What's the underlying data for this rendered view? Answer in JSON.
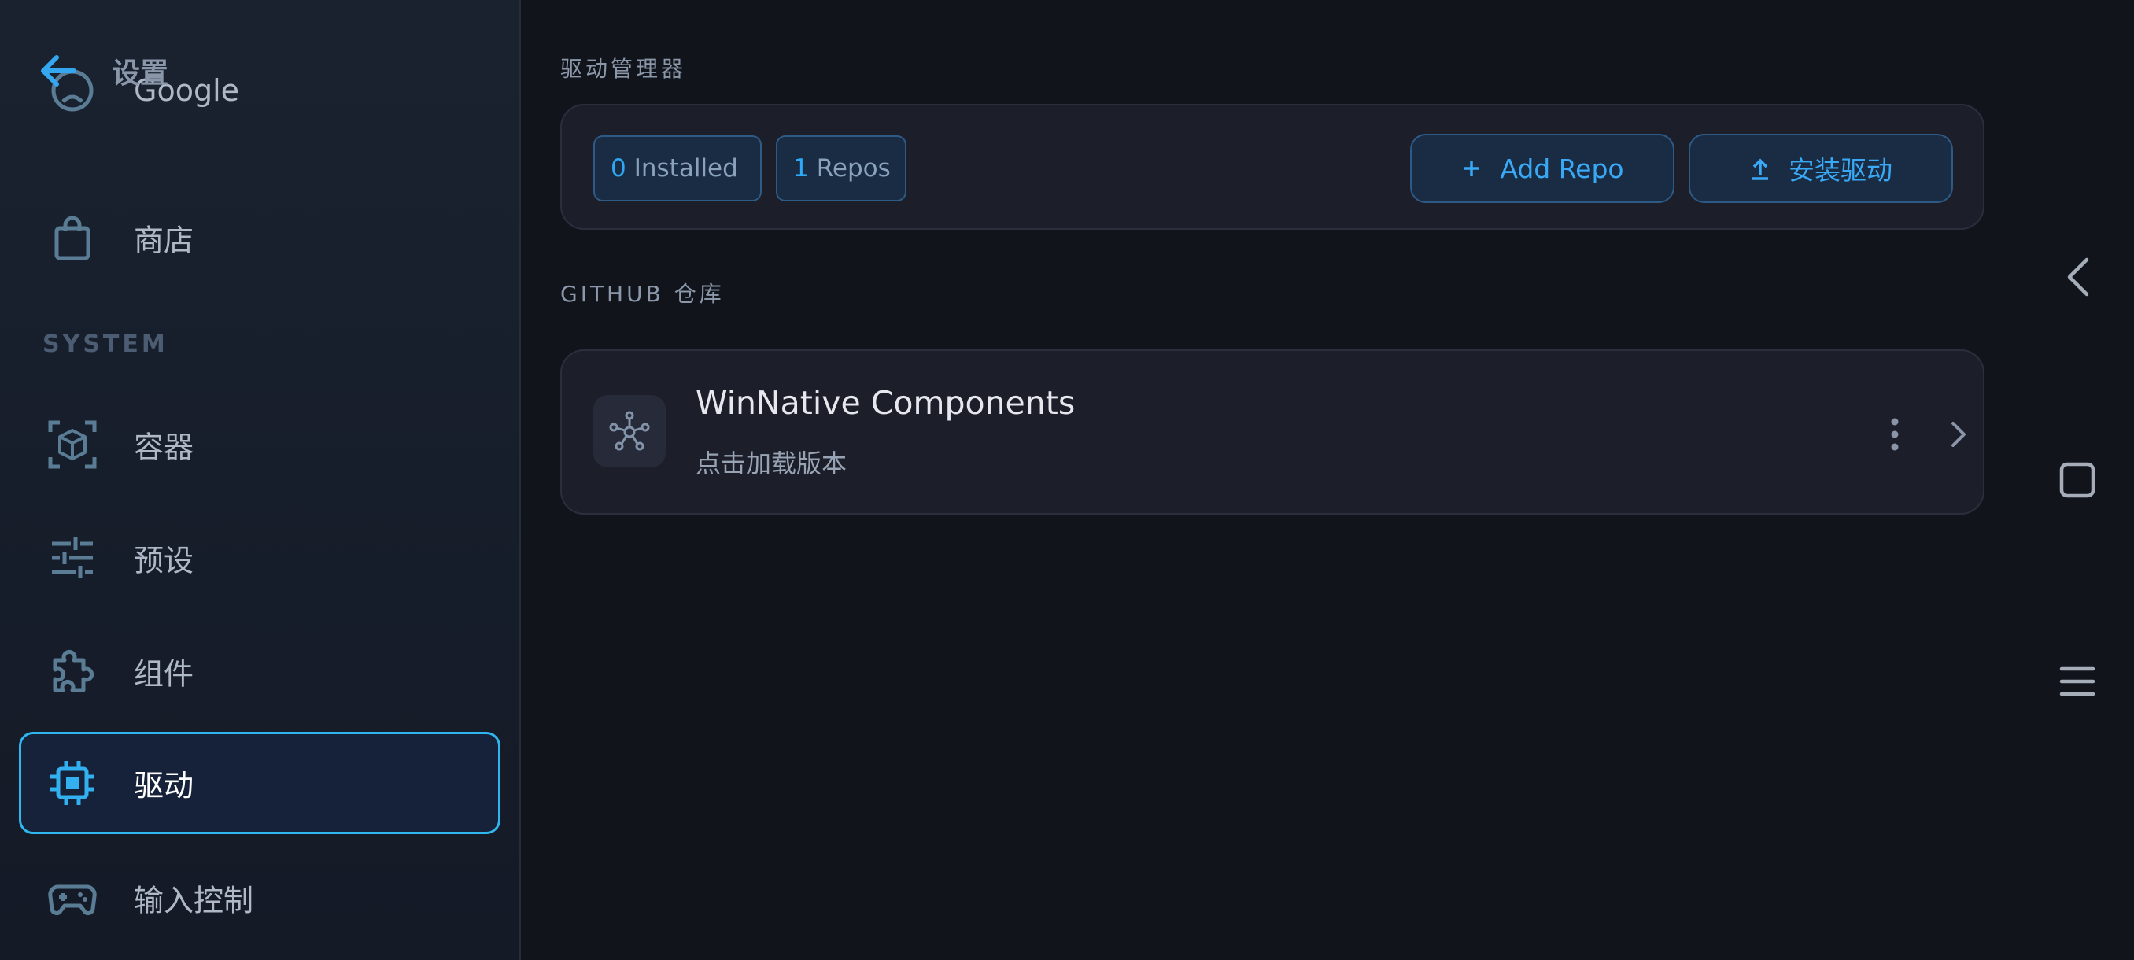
{
  "header": {
    "title": "设置",
    "back_icon": "arrow-left-icon"
  },
  "sidebar": {
    "section_label": "SYSTEM",
    "items": [
      {
        "label": "Google",
        "icon": "account-icon"
      },
      {
        "label": "商店",
        "icon": "shopping-bag-icon"
      },
      {
        "label": "容器",
        "icon": "container-icon"
      },
      {
        "label": "预设",
        "icon": "sliders-icon"
      },
      {
        "label": "组件",
        "icon": "puzzle-icon"
      },
      {
        "label": "驱动",
        "icon": "chip-icon",
        "active": true
      },
      {
        "label": "输入控制",
        "icon": "gamepad-icon"
      }
    ]
  },
  "main": {
    "section_title": "驱动管理器",
    "stats": {
      "installed_count": "0",
      "installed_label": "Installed",
      "repos_count": "1",
      "repos_label": "Repos"
    },
    "buttons": {
      "add_repo": "Add Repo",
      "install_driver": "安装驱动"
    },
    "github_label": "GITHUB 仓库",
    "repo": {
      "title": "WinNative Components",
      "subtitle": "点击加载版本",
      "icon": "hub-icon"
    }
  },
  "system_nav": {
    "back": "back-icon",
    "home": "square-icon",
    "menu": "menu-icon"
  },
  "colors": {
    "accent": "#30b6ee",
    "background": "#12141c",
    "sidebar": "#1a2230",
    "card": "#1c1e2a"
  }
}
